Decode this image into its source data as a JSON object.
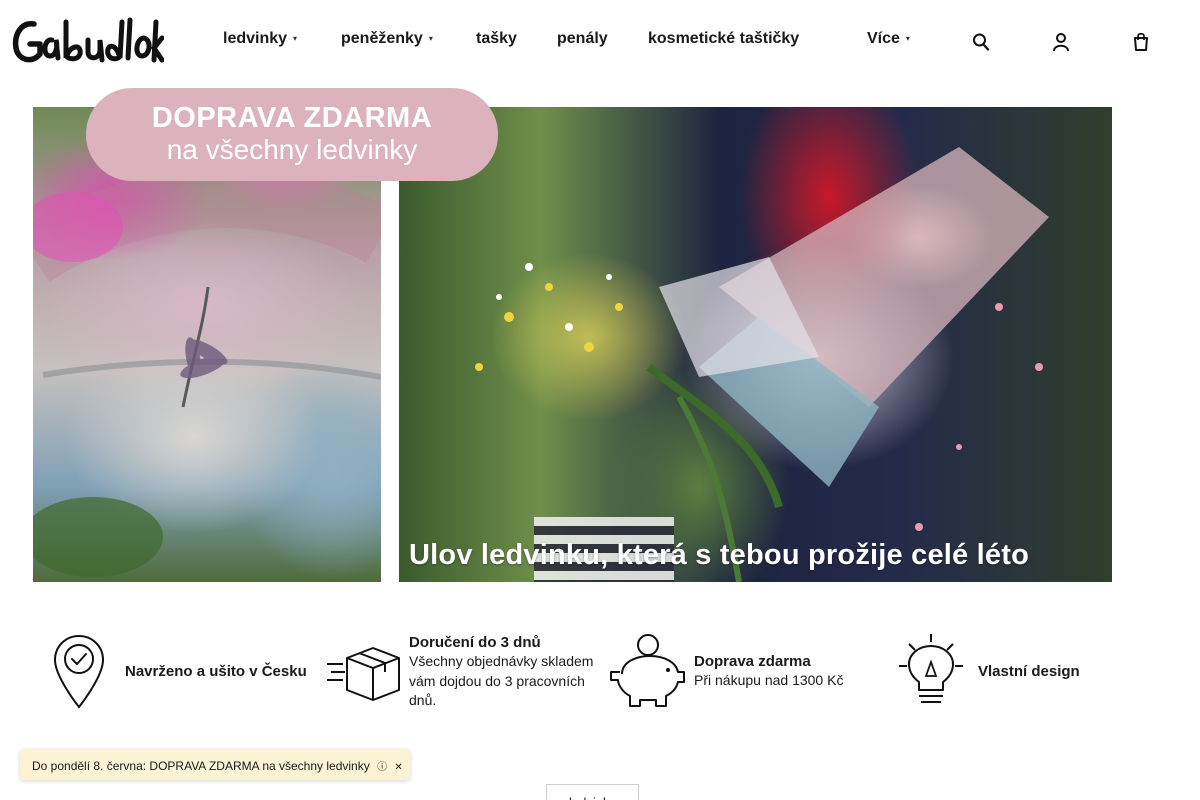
{
  "brand": {
    "logo_text": "Gabudlok"
  },
  "nav": {
    "items": [
      {
        "label": "ledvinky",
        "has_caret": true
      },
      {
        "label": "peněženky",
        "has_caret": true
      },
      {
        "label": "tašky",
        "has_caret": false
      },
      {
        "label": "penály",
        "has_caret": false
      },
      {
        "label": "kosmetické taštičky",
        "has_caret": false
      },
      {
        "label": "Více",
        "has_caret": true
      }
    ],
    "caret_glyph": "▾",
    "icons": [
      "search-icon",
      "user-icon",
      "cart-icon"
    ]
  },
  "hero": {
    "promo_line1": "DOPRAVA ZDARMA",
    "promo_line2": "na všechny ledvinky",
    "caption": "Ulov ledvinku, která s tebou prožije celé léto",
    "promo_color": "#dcb2bd"
  },
  "features": [
    {
      "icon": "map-pin-check-icon",
      "title": "Navrženo a ušito v Česku",
      "text": ""
    },
    {
      "icon": "delivery-box-icon",
      "title": "Doručení do 3 dnů",
      "text": "Všechny objednávky skladem vám dojdou do 3 pracovních dnů."
    },
    {
      "icon": "piggy-bank-icon",
      "title": "Doprava zdarma",
      "text": "Při nákupu nad 1300 Kč"
    },
    {
      "icon": "lightbulb-pen-icon",
      "title": "Vlastní design",
      "text": ""
    }
  ],
  "notice": {
    "text": "Do pondělí 8. června: DOPRAVA ZDARMA na všechny ledvinky",
    "close_glyph": "✕"
  },
  "partial_button": {
    "label": "ledvinky"
  }
}
